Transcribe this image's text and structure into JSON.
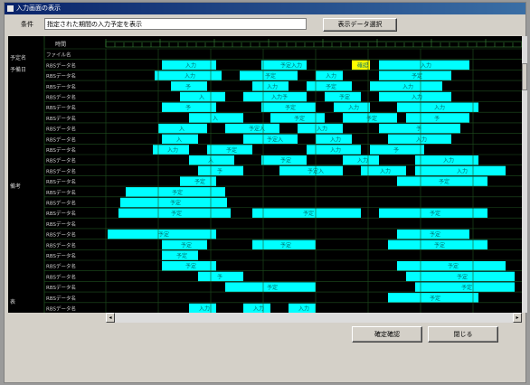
{
  "window": {
    "title": "入力画面の表示"
  },
  "search": {
    "label": "条件",
    "value": "指定された期間の入力予定を表示"
  },
  "buttons": {
    "select": "表示データ選択",
    "ok": "確定確認",
    "close": "閉じる"
  },
  "header": {
    "label": "時間"
  },
  "sections": [
    "予定名",
    "予備日",
    "備考",
    "表"
  ],
  "rows": [
    {
      "label": "ファイル名",
      "bars": [],
      "row_type": "header"
    },
    {
      "label": "RBSデータ名",
      "bars": [
        {
          "start": 62,
          "end": 122,
          "text": "入力"
        },
        {
          "start": 172,
          "end": 222,
          "text": "予定入力"
        },
        {
          "start": 272,
          "end": 292,
          "text": "確認",
          "highlight": true
        },
        {
          "start": 302,
          "end": 402,
          "text": "入力"
        }
      ]
    },
    {
      "label": "RBSデータ名",
      "bars": [
        {
          "start": 54,
          "end": 128,
          "text": "入力"
        },
        {
          "start": 148,
          "end": 212,
          "text": "予定"
        },
        {
          "start": 232,
          "end": 262,
          "text": "入力"
        },
        {
          "start": 302,
          "end": 382,
          "text": "予定"
        }
      ]
    },
    {
      "label": "RBSデータ名",
      "bars": [
        {
          "start": 72,
          "end": 112,
          "text": "予"
        },
        {
          "start": 162,
          "end": 202,
          "text": "入力"
        },
        {
          "start": 222,
          "end": 272,
          "text": "予定"
        },
        {
          "start": 292,
          "end": 372,
          "text": "入力"
        }
      ]
    },
    {
      "label": "RBSデータ名",
      "bars": [
        {
          "start": 82,
          "end": 132,
          "text": "入"
        },
        {
          "start": 152,
          "end": 222,
          "text": "入力予"
        },
        {
          "start": 242,
          "end": 282,
          "text": "予定"
        },
        {
          "start": 302,
          "end": 382,
          "text": "入力"
        }
      ]
    },
    {
      "label": "RBSデータ名",
      "bars": [
        {
          "start": 62,
          "end": 122,
          "text": "予"
        },
        {
          "start": 172,
          "end": 232,
          "text": "予定"
        },
        {
          "start": 252,
          "end": 292,
          "text": "入力"
        },
        {
          "start": 322,
          "end": 412,
          "text": "入力"
        }
      ]
    },
    {
      "label": "RBSデータ名",
      "bars": [
        {
          "start": 92,
          "end": 152,
          "text": "入"
        },
        {
          "start": 182,
          "end": 242,
          "text": "予定"
        },
        {
          "start": 262,
          "end": 322,
          "text": "予定"
        },
        {
          "start": 332,
          "end": 402,
          "text": "予"
        }
      ]
    },
    {
      "label": "RBSデータ名",
      "bars": [
        {
          "start": 58,
          "end": 112,
          "text": "入"
        },
        {
          "start": 132,
          "end": 192,
          "text": "予定入"
        },
        {
          "start": 212,
          "end": 262,
          "text": "入力"
        },
        {
          "start": 302,
          "end": 392,
          "text": "予"
        }
      ]
    },
    {
      "label": "RBSデータ名",
      "bars": [
        {
          "start": 62,
          "end": 102,
          "text": "入"
        },
        {
          "start": 152,
          "end": 212,
          "text": "予定入"
        },
        {
          "start": 232,
          "end": 272,
          "text": "入力"
        },
        {
          "start": 312,
          "end": 382,
          "text": "入力"
        }
      ]
    },
    {
      "label": "RBSデータ名",
      "bars": [
        {
          "start": 52,
          "end": 92,
          "text": "入力"
        },
        {
          "start": 112,
          "end": 162,
          "text": "予定"
        },
        {
          "start": 222,
          "end": 282,
          "text": "入力"
        },
        {
          "start": 292,
          "end": 352,
          "text": "予"
        }
      ]
    },
    {
      "label": "RBSデータ名",
      "bars": [
        {
          "start": 92,
          "end": 142,
          "text": "入"
        },
        {
          "start": 172,
          "end": 222,
          "text": "予定"
        },
        {
          "start": 262,
          "end": 302,
          "text": "入力"
        },
        {
          "start": 342,
          "end": 412,
          "text": "入力"
        }
      ]
    },
    {
      "label": "RBSデータ名",
      "bars": [
        {
          "start": 102,
          "end": 152,
          "text": "予"
        },
        {
          "start": 192,
          "end": 262,
          "text": "予定入"
        },
        {
          "start": 282,
          "end": 332,
          "text": "入力"
        },
        {
          "start": 342,
          "end": 442,
          "text": "入力"
        }
      ]
    },
    {
      "label": "RBSデータ名",
      "bars": [
        {
          "start": 82,
          "end": 122,
          "text": "予定"
        },
        {
          "start": 322,
          "end": 422,
          "text": "予定"
        }
      ]
    },
    {
      "label": "RBSデータ名",
      "bars": [
        {
          "start": 22,
          "end": 132,
          "text": "予定"
        }
      ]
    },
    {
      "label": "RBSデータ名",
      "bars": [
        {
          "start": 16,
          "end": 134,
          "text": "予定"
        }
      ]
    },
    {
      "label": "RBSデータ名",
      "bars": [
        {
          "start": 14,
          "end": 138,
          "text": "予定"
        },
        {
          "start": 162,
          "end": 282,
          "text": "予定"
        },
        {
          "start": 302,
          "end": 422,
          "text": "予定"
        }
      ]
    },
    {
      "label": "RBSデータ名",
      "bars": []
    },
    {
      "label": "RBSデータ名",
      "bars": [
        {
          "start": 2,
          "end": 122,
          "text": "予定"
        },
        {
          "start": 322,
          "end": 402,
          "text": "予定"
        }
      ]
    },
    {
      "label": "RBSデータ名",
      "bars": [
        {
          "start": 62,
          "end": 112,
          "text": "予定"
        },
        {
          "start": 162,
          "end": 232,
          "text": "予定"
        },
        {
          "start": 312,
          "end": 422,
          "text": "予定"
        }
      ]
    },
    {
      "label": "RBSデータ名",
      "bars": [
        {
          "start": 62,
          "end": 102,
          "text": "予定"
        }
      ]
    },
    {
      "label": "RBSデータ名",
      "bars": [
        {
          "start": 62,
          "end": 122,
          "text": "予定"
        },
        {
          "start": 322,
          "end": 442,
          "text": "予定"
        }
      ]
    },
    {
      "label": "RBSデータ名",
      "bars": [
        {
          "start": 102,
          "end": 152,
          "text": "予"
        },
        {
          "start": 332,
          "end": 452,
          "text": "予定"
        }
      ]
    },
    {
      "label": "RBSデータ名",
      "bars": [
        {
          "start": 132,
          "end": 232,
          "text": "予定"
        },
        {
          "start": 342,
          "end": 452,
          "text": "予定"
        }
      ]
    },
    {
      "label": "RBSデータ名",
      "bars": [
        {
          "start": 312,
          "end": 412,
          "text": "予定"
        }
      ]
    },
    {
      "label": "RBSデータ名",
      "bars": [
        {
          "start": 92,
          "end": 122,
          "text": "入力"
        },
        {
          "start": 152,
          "end": 182,
          "text": "入力"
        },
        {
          "start": 202,
          "end": 232,
          "text": "入力"
        }
      ]
    }
  ],
  "colors": {
    "background": "#000000",
    "bar": "#00ffff",
    "bar_highlight": "#ffff00",
    "grid": "#1f4f1f",
    "label_text": "#d0d0d0",
    "bar_text": "#007070"
  }
}
